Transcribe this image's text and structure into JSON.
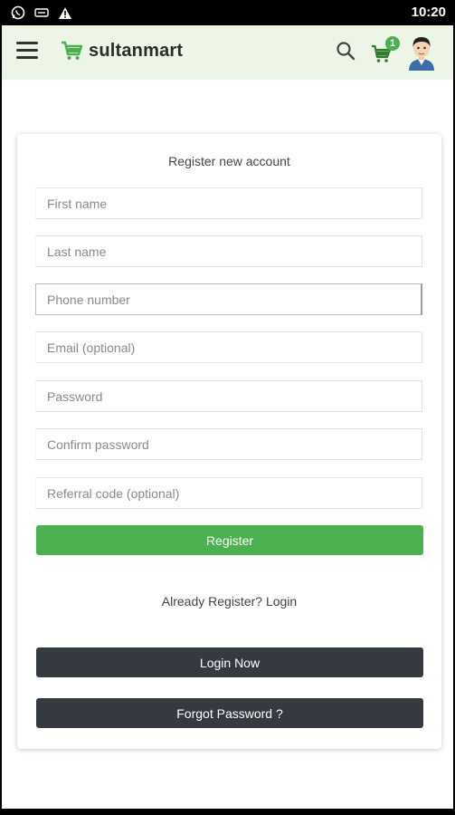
{
  "status_bar": {
    "time": "10:20",
    "icons": [
      "whatsapp-icon",
      "voicemail-icon",
      "warning-icon"
    ]
  },
  "app_bar": {
    "brand": "sultanmart",
    "cart_count": "1",
    "icons": [
      "menu-icon",
      "cart-logo-icon",
      "search-icon",
      "cart-icon",
      "avatar-icon"
    ],
    "accent_color": "#4caf50",
    "bar_color": "#edf6e6"
  },
  "form": {
    "title": "Register new account",
    "fields": {
      "first_name": {
        "placeholder": "First name",
        "value": ""
      },
      "last_name": {
        "placeholder": "Last name",
        "value": ""
      },
      "phone": {
        "placeholder": "Phone number",
        "value": ""
      },
      "email": {
        "placeholder": "Email (optional)",
        "value": ""
      },
      "password": {
        "placeholder": "Password",
        "value": ""
      },
      "confirm_password": {
        "placeholder": "Confirm password",
        "value": ""
      },
      "referral": {
        "placeholder": "Referral code (optional)",
        "value": ""
      }
    },
    "register_label": "Register",
    "already_label": "Already Register? Login",
    "login_now_label": "Login Now",
    "forgot_label": "Forgot Password ?",
    "dark_button_color": "#353a40"
  }
}
